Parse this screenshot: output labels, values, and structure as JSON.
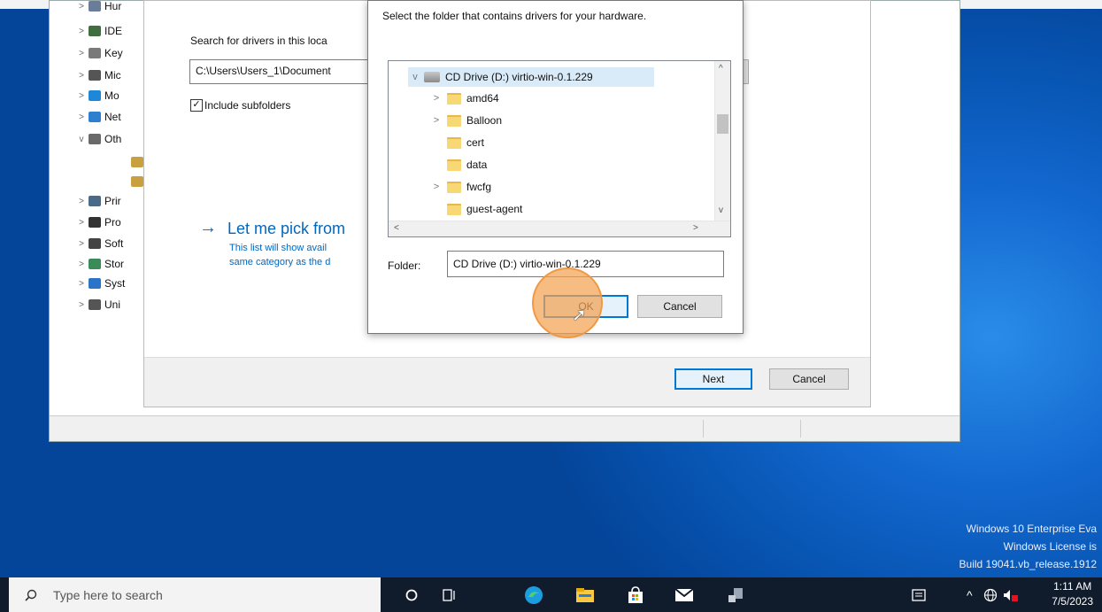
{
  "device_tree": {
    "items": [
      {
        "label": "Hur",
        "chevron": ">",
        "color": "#6a7d98"
      },
      {
        "label": "IDE",
        "chevron": ">",
        "color": "#3f6f3f"
      },
      {
        "label": "Key",
        "chevron": ">",
        "color": "#7a7a7a"
      },
      {
        "label": "Mic",
        "chevron": ">",
        "color": "#555555"
      },
      {
        "label": "Mo",
        "chevron": ">",
        "color": "#1e88d8"
      },
      {
        "label": "Net",
        "chevron": ">",
        "color": "#2d7fd0"
      },
      {
        "label": "Oth",
        "chevron": "v",
        "color": "#6a6a6a"
      },
      {
        "label": "",
        "chevron": "",
        "color": "#c9a040"
      },
      {
        "label": "",
        "chevron": "",
        "color": "#c9a040"
      },
      {
        "label": "Prir",
        "chevron": ">",
        "color": "#4a6a8a"
      },
      {
        "label": "Pro",
        "chevron": ">",
        "color": "#333333"
      },
      {
        "label": "Soft",
        "chevron": ">",
        "color": "#444444"
      },
      {
        "label": "Stor",
        "chevron": ">",
        "color": "#3a8a5a"
      },
      {
        "label": "Syst",
        "chevron": ">",
        "color": "#2a74c8"
      },
      {
        "label": "Uni",
        "chevron": ">",
        "color": "#555555"
      }
    ]
  },
  "wizard": {
    "search_label": "Search for drivers in this loca",
    "path_value": "C:\\Users\\Users_1\\Document",
    "include_subfolders": "Include subfolders",
    "checkbox_mark": "✓",
    "pick_arrow": "→",
    "pick_link": "Let me pick from",
    "pick_desc_1": "This list will show avail",
    "pick_desc_2": "same category as the d",
    "next": "Next",
    "cancel": "Cancel"
  },
  "browse_dialog": {
    "instruction": "Select the folder that contains drivers for your hardware.",
    "drive": {
      "label": "CD Drive (D:) virtio-win-0.1.229",
      "chevron": "v"
    },
    "folders": [
      {
        "label": "amd64",
        "chevron": ">"
      },
      {
        "label": "Balloon",
        "chevron": ">"
      },
      {
        "label": "cert",
        "chevron": ""
      },
      {
        "label": "data",
        "chevron": ""
      },
      {
        "label": "fwcfg",
        "chevron": ">"
      },
      {
        "label": "guest-agent",
        "chevron": ""
      }
    ],
    "scroll_up": "^",
    "scroll_down": "v",
    "scroll_left": "<",
    "scroll_right": ">",
    "folder_label": "Folder:",
    "folder_value": "CD Drive (D:) virtio-win-0.1.229",
    "ok": "OK",
    "cancel": "Cancel"
  },
  "watermark": {
    "line1": "Windows 10 Enterprise Eva",
    "line2": "Windows License is",
    "line3": "Build 19041.vb_release.1912"
  },
  "taskbar": {
    "search_placeholder": "Type here to search",
    "time": "1:11 AM",
    "date": "7/5/2023",
    "icons": [
      "cortana-icon",
      "task-view-icon",
      "edge-icon",
      "file-explorer-icon",
      "store-icon",
      "mail-icon",
      "device-manager-icon"
    ]
  },
  "colors": {
    "accent": "#0078d7",
    "link": "#0067c0",
    "highlight": "#f4a252",
    "taskbar": "#101b2b"
  }
}
